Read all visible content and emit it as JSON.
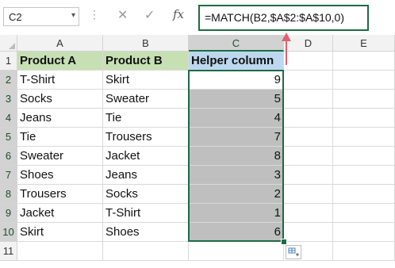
{
  "formula_bar": {
    "name_box": "C2",
    "name_box_arrow": "▾",
    "dots": "⋮",
    "cancel": "✕",
    "enter": "✓",
    "fx": "fx",
    "formula": "=MATCH(B2,$A$2:$A$10,0)"
  },
  "columns": [
    "A",
    "B",
    "C",
    "D",
    "E"
  ],
  "rows": [
    "1",
    "2",
    "3",
    "4",
    "5",
    "6",
    "7",
    "8",
    "9",
    "10",
    "11"
  ],
  "table": {
    "headers": [
      "Product A",
      "Product B",
      "Helper column"
    ],
    "data": [
      [
        "T-Shirt",
        "Skirt",
        "9"
      ],
      [
        "Socks",
        "Sweater",
        "5"
      ],
      [
        "Jeans",
        "Tie",
        "4"
      ],
      [
        "Tie",
        "Trousers",
        "7"
      ],
      [
        "Sweater",
        "Jacket",
        "8"
      ],
      [
        "Shoes",
        "Jeans",
        "3"
      ],
      [
        "Trousers",
        "Socks",
        "2"
      ],
      [
        "Jacket",
        "T-Shirt",
        "1"
      ],
      [
        "Skirt",
        "Shoes",
        "6"
      ]
    ]
  },
  "colors": {
    "header_a_b": "#c6e0b4",
    "header_c": "#bdd7ee",
    "helper_fill": "#bfbfbf",
    "selection": "#1e6b45",
    "arrow": "#e06070"
  }
}
